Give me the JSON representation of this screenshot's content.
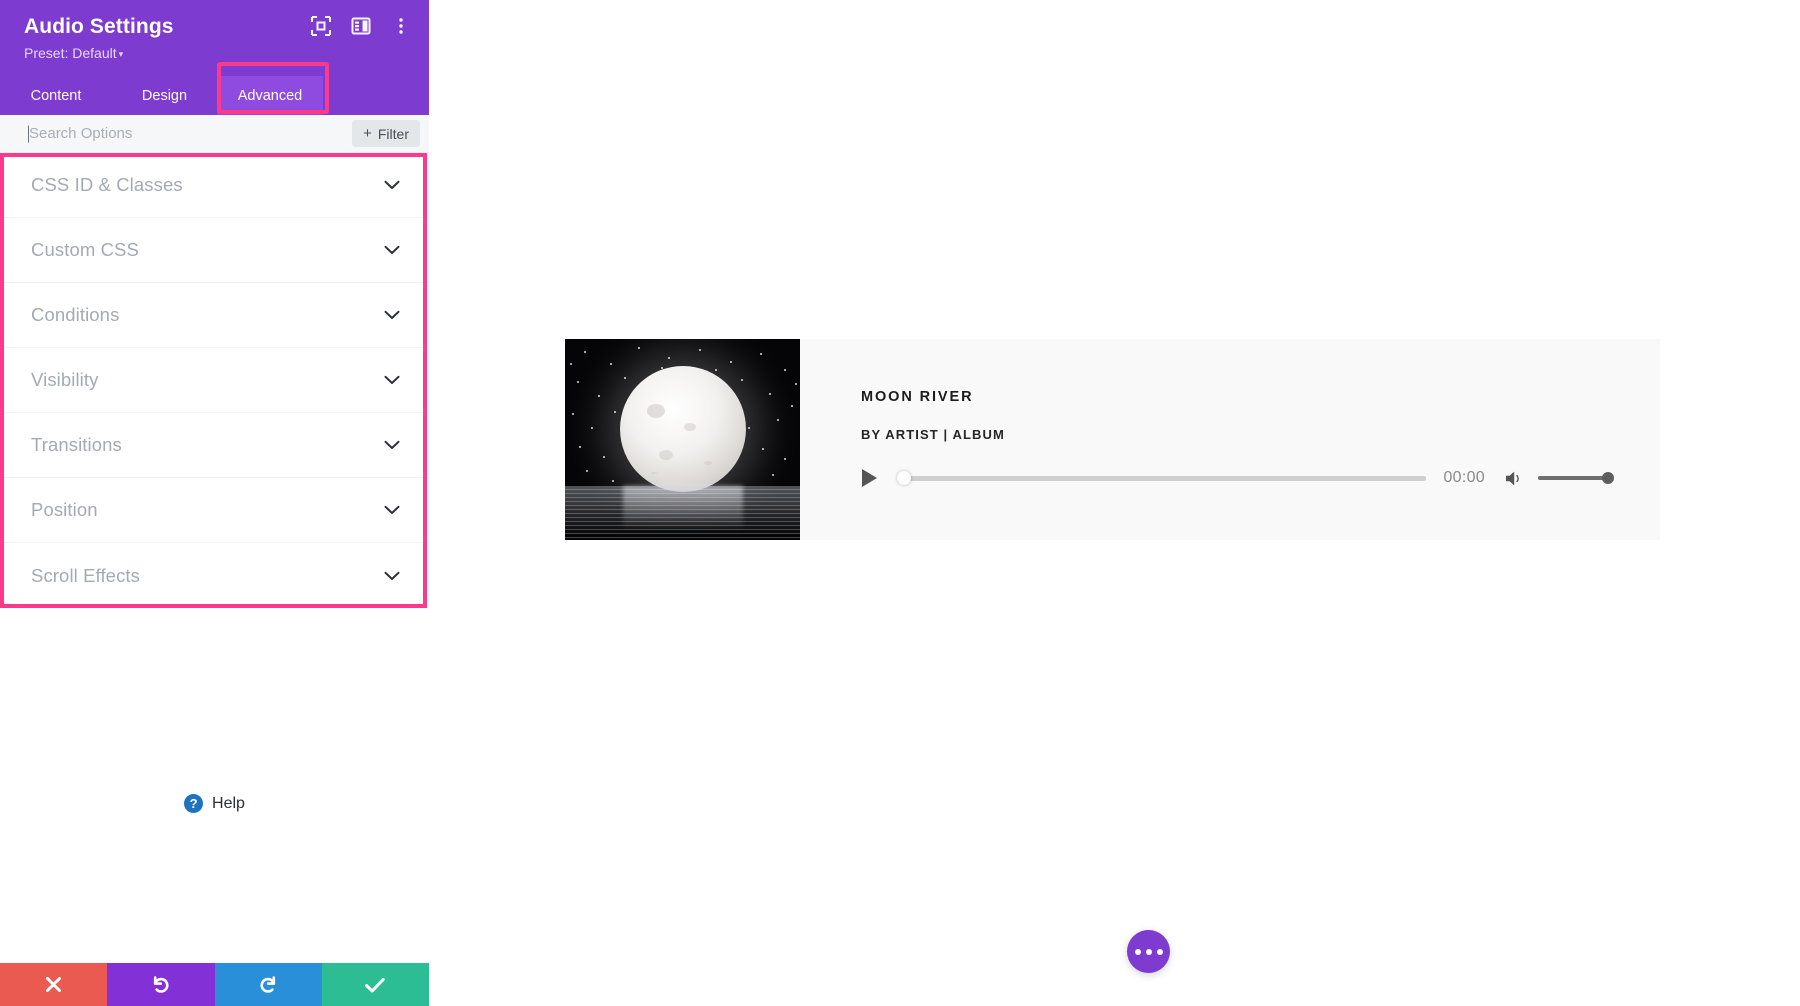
{
  "panel": {
    "title": "Audio Settings",
    "preset_label": "Preset: Default",
    "preset_caret": "▾",
    "header_icons": [
      {
        "name": "focus-icon"
      },
      {
        "name": "layout-panel-icon"
      },
      {
        "name": "more-vertical-icon"
      }
    ],
    "tabs": [
      {
        "label": "Content",
        "active": false
      },
      {
        "label": "Design",
        "active": false
      },
      {
        "label": "Advanced",
        "active": true
      }
    ],
    "search": {
      "value": "",
      "placeholder": "Search Options"
    },
    "filter": {
      "label": "Filter",
      "plus": "+"
    },
    "accordion": [
      {
        "label": "CSS ID & Classes"
      },
      {
        "label": "Custom CSS"
      },
      {
        "label": "Conditions"
      },
      {
        "label": "Visibility"
      },
      {
        "label": "Transitions"
      },
      {
        "label": "Position"
      },
      {
        "label": "Scroll Effects"
      }
    ],
    "help": {
      "label": "Help",
      "icon_glyph": "?"
    },
    "actions": [
      {
        "name": "cancel",
        "glyph": "✕",
        "color": "#eb5a51"
      },
      {
        "name": "undo",
        "glyph": "↺",
        "color": "#8331d6"
      },
      {
        "name": "redo",
        "glyph": "↻",
        "color": "#2a8fd9"
      },
      {
        "name": "save",
        "glyph": "✓",
        "color": "#2cbd95"
      }
    ]
  },
  "highlights": {
    "color": "#fc3a8c",
    "targets": [
      "advanced-tab",
      "advanced-options-list"
    ]
  },
  "preview": {
    "audio": {
      "title": "MOON RIVER",
      "subtitle": "BY ARTIST | ALBUM",
      "current_time": "00:00",
      "progress_percent": 0,
      "volume_percent": 100,
      "play_state": "paused"
    },
    "fab": {
      "label": "•••"
    }
  },
  "colors": {
    "header_purple": "#7e3bd0",
    "tab_active_purple": "#8f4ae0",
    "highlight_pink": "#fc3a8c",
    "help_blue": "#1e73be",
    "card_bg": "#f9f9f9"
  }
}
